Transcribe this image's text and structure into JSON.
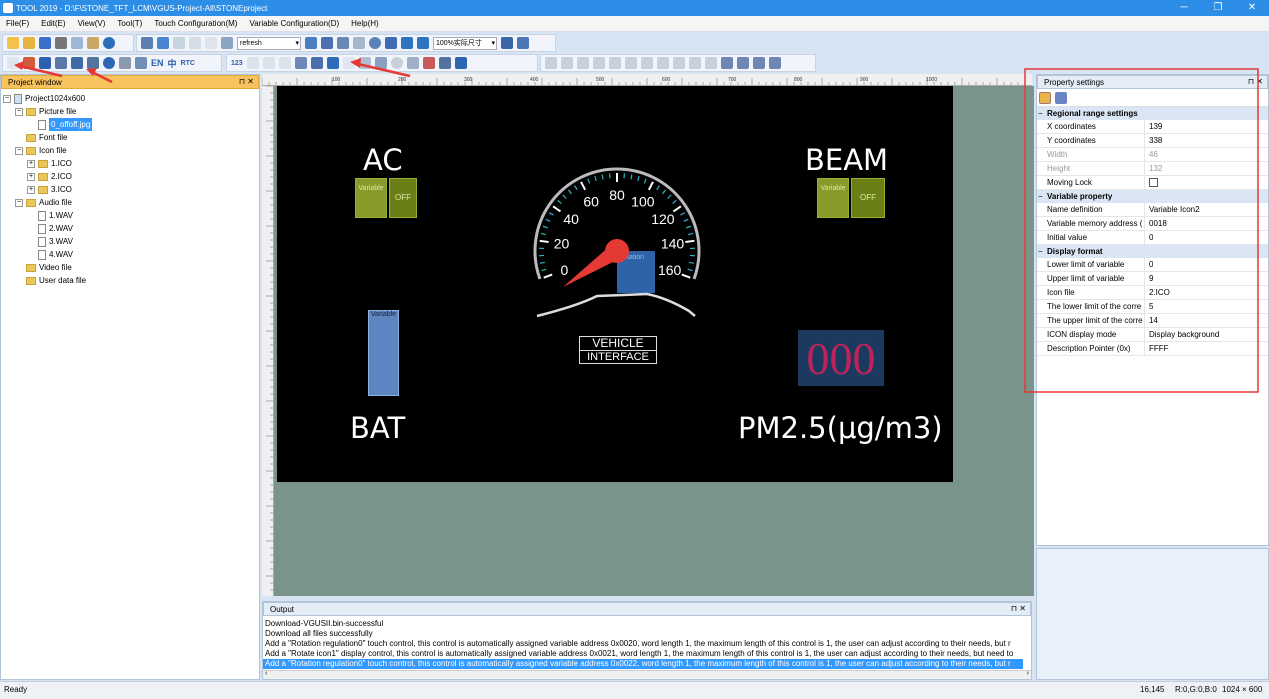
{
  "window": {
    "title": "TOOL 2019 - D:\\F\\STONE_TFT_LCM\\VGUS-Project-All\\STONEproject",
    "minimize": "─",
    "maximize": "❐",
    "close": "✕"
  },
  "menu": [
    "File(F)",
    "Edit(E)",
    "View(V)",
    "Tool(T)",
    "Touch Configuration(M)",
    "Variable Configuration(D)",
    "Help(H)"
  ],
  "toolbar": {
    "refresh_value": "refresh",
    "zoom_value": "100%实际尺寸",
    "lang_en": "EN",
    "lang_cn": "中",
    "rtc": "RTC",
    "num": "123"
  },
  "project_window": {
    "title": "Project window",
    "root": "Project1024x600",
    "items": [
      {
        "label": "Picture file",
        "level": 1,
        "kind": "folder"
      },
      {
        "label": "0_offoff.jpg",
        "level": 2,
        "kind": "file",
        "selected": true
      },
      {
        "label": "Font file",
        "level": 1,
        "kind": "folder"
      },
      {
        "label": "Icon file",
        "level": 1,
        "kind": "folder"
      },
      {
        "label": "1.ICO",
        "level": 2,
        "kind": "folder"
      },
      {
        "label": "2.ICO",
        "level": 2,
        "kind": "folder"
      },
      {
        "label": "3.ICO",
        "level": 2,
        "kind": "folder"
      },
      {
        "label": "Audio file",
        "level": 1,
        "kind": "folder"
      },
      {
        "label": "1.WAV",
        "level": 2,
        "kind": "file"
      },
      {
        "label": "2.WAV",
        "level": 2,
        "kind": "file"
      },
      {
        "label": "3.WAV",
        "level": 2,
        "kind": "file"
      },
      {
        "label": "4.WAV",
        "level": 2,
        "kind": "file"
      },
      {
        "label": "Video file",
        "level": 1,
        "kind": "folder"
      },
      {
        "label": "User data file",
        "level": 1,
        "kind": "folder"
      }
    ]
  },
  "canvas": {
    "ac_label": "AC",
    "beam_label": "BEAM",
    "bat_label": "BAT",
    "pm_label": "PM2.5(μg/m3)",
    "variable_text": "Variable",
    "off_text": "OFF",
    "rotation_text": "Rotation",
    "vehicle_line1": "VEHICLE",
    "vehicle_line2": "INTERFACE",
    "pm_value": "000",
    "gauge_ticks": [
      "0",
      "20",
      "40",
      "60",
      "80",
      "100",
      "120",
      "140",
      "160"
    ]
  },
  "ruler_ticks": [
    "100",
    "200",
    "300",
    "400",
    "500",
    "600",
    "700",
    "800",
    "900",
    "1000"
  ],
  "property_settings": {
    "title": "Property settings",
    "categories": [
      {
        "name": "Regional range settings",
        "rows": [
          {
            "key": "X coordinates",
            "value": "139"
          },
          {
            "key": "Y coordinates",
            "value": "338"
          },
          {
            "key": "Width",
            "value": "46"
          },
          {
            "key": "Height",
            "value": "132"
          },
          {
            "key": "Moving Lock",
            "value": ""
          }
        ]
      },
      {
        "name": "Variable property",
        "rows": [
          {
            "key": "Name definition",
            "value": "Variable Icon2"
          },
          {
            "key": "Variable memory address (",
            "value": "0018"
          },
          {
            "key": "Initial value",
            "value": "0"
          }
        ]
      },
      {
        "name": "Display format",
        "rows": [
          {
            "key": "Lower limit of variable",
            "value": "0"
          },
          {
            "key": "Upper limit of variable",
            "value": "9"
          },
          {
            "key": "Icon file",
            "value": "2.ICO"
          },
          {
            "key": "The lower limit of the corre",
            "value": "5"
          },
          {
            "key": "The upper limit of the corre",
            "value": "14"
          },
          {
            "key": "ICON display mode",
            "value": "Display background"
          },
          {
            "key": "Description Pointer (0x)",
            "value": "FFFF"
          }
        ]
      }
    ]
  },
  "output": {
    "title": "Output",
    "lines": [
      "Download-VGUSII.bin-successful",
      "Download all files successfully",
      "Add a \"Rotation regulation0\" touch control, this control is automatically assigned variable address 0x0020, word length 1, the maximum length of this control is 1, the user can adjust according to their needs, but r",
      "Add a \"Rotate icon1\" display control, this control is automatically assigned variable address 0x0021, word length 1, the maximum length of this control is 1, the user can adjust according to their needs, but need to",
      "Add a \"Rotation regulation0\" touch control, this control is automatically assigned variable address 0x0022, word length 1, the maximum length of this control is 1, the user can adjust according to their needs, but r"
    ]
  },
  "statusbar": {
    "status": "Ready",
    "coords": "16,145",
    "color": "R:0,G:0,B:0",
    "resolution": "1024 × 600"
  },
  "colors": {
    "accent": "#2c8ee6",
    "canvas_bg": "#000000",
    "workspace": "#7a948c",
    "highlight": "#e53935",
    "selection": "#3399ff"
  }
}
